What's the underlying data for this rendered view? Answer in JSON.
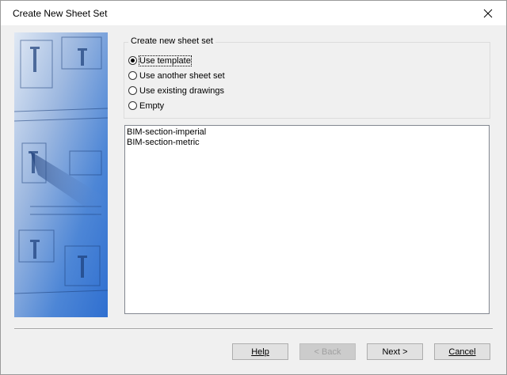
{
  "window": {
    "title": "Create New Sheet Set"
  },
  "group": {
    "legend": "Create new sheet set",
    "options": [
      {
        "label": "Use template",
        "checked": true
      },
      {
        "label": "Use another sheet set",
        "checked": false
      },
      {
        "label": "Use existing drawings",
        "checked": false
      },
      {
        "label": "Empty",
        "checked": false
      }
    ]
  },
  "templates": [
    "BIM-section-imperial",
    "BIM-section-metric"
  ],
  "buttons": {
    "help": "Help",
    "back": "< Back",
    "next": "Next >",
    "cancel": "Cancel"
  },
  "icons": {
    "close": "close-icon"
  },
  "colors": {
    "image_blue": "#3a7bd5",
    "image_light": "#c8d6ec"
  }
}
